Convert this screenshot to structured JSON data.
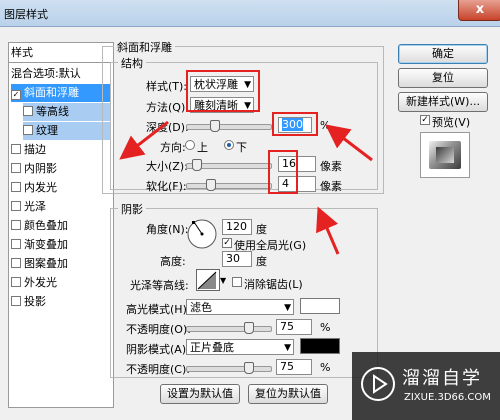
{
  "window": {
    "title": "图层样式",
    "close_label": "x"
  },
  "sidebar": {
    "header": "样式",
    "items": [
      {
        "label": "混合选项:默认",
        "checkbox": false,
        "state": "normal"
      },
      {
        "label": "斜面和浮雕",
        "checkbox": true,
        "checked": true,
        "state": "selected"
      },
      {
        "label": "等高线",
        "checkbox": true,
        "checked": false,
        "state": "sub"
      },
      {
        "label": "纹理",
        "checkbox": true,
        "checked": false,
        "state": "sub"
      },
      {
        "label": "描边",
        "checkbox": true,
        "checked": false,
        "state": "normal"
      },
      {
        "label": "内阴影",
        "checkbox": true,
        "checked": false,
        "state": "normal"
      },
      {
        "label": "内发光",
        "checkbox": true,
        "checked": false,
        "state": "normal"
      },
      {
        "label": "光泽",
        "checkbox": true,
        "checked": false,
        "state": "normal"
      },
      {
        "label": "颜色叠加",
        "checkbox": true,
        "checked": false,
        "state": "normal"
      },
      {
        "label": "渐变叠加",
        "checkbox": true,
        "checked": false,
        "state": "normal"
      },
      {
        "label": "图案叠加",
        "checkbox": true,
        "checked": false,
        "state": "normal"
      },
      {
        "label": "外发光",
        "checkbox": true,
        "checked": false,
        "state": "normal"
      },
      {
        "label": "投影",
        "checkbox": true,
        "checked": false,
        "state": "normal"
      }
    ]
  },
  "bevel": {
    "section_title": "斜面和浮雕",
    "structure_title": "结构",
    "style_label": "样式(T):",
    "style_value": "枕状浮雕",
    "technique_label": "方法(Q):",
    "technique_value": "雕刻清晰",
    "depth_label": "深度(D):",
    "depth_value": "300",
    "depth_unit": "%",
    "depth_slider": 0.3,
    "direction_label": "方向:",
    "direction_up": "上",
    "direction_down": "下",
    "direction_selected": "down",
    "size_label": "大小(Z):",
    "size_value": "16",
    "size_unit": "像素",
    "size_slider": 0.06,
    "soften_label": "软化(F):",
    "soften_value": "4",
    "soften_unit": "像素",
    "soften_slider": 0.25
  },
  "shading": {
    "title": "阴影",
    "angle_label": "角度(N):",
    "angle_value": "120",
    "angle_unit": "度",
    "global_light_label": "使用全局光(G)",
    "global_light_checked": true,
    "altitude_label": "高度:",
    "altitude_value": "30",
    "altitude_unit": "度",
    "gloss_contour_label": "光泽等高线:",
    "anti_alias_label": "消除锯齿(L)",
    "anti_alias_checked": false,
    "highlight_mode_label": "高光模式(H):",
    "highlight_mode_value": "滤色",
    "highlight_color": "#ffffff",
    "highlight_opacity_label": "不透明度(O):",
    "highlight_opacity_value": "75",
    "highlight_opacity_unit": "%",
    "highlight_opacity_slider": 0.75,
    "shadow_mode_label": "阴影模式(A):",
    "shadow_mode_value": "正片叠底",
    "shadow_color": "#000000",
    "shadow_opacity_label": "不透明度(C):",
    "shadow_opacity_value": "75",
    "shadow_opacity_unit": "%",
    "shadow_opacity_slider": 0.75
  },
  "footer": {
    "make_default": "设置为默认值",
    "reset_default": "复位为默认值"
  },
  "buttons": {
    "ok": "确定",
    "reset": "复位",
    "new_style": "新建样式(W)...",
    "preview_label": "预览(V)",
    "preview_checked": true
  },
  "watermark": {
    "title": "溜溜自学",
    "url": "ZIXUE.3D66.COM"
  },
  "colors": {
    "annotation": "#e52222",
    "selection": "#3399ff"
  }
}
